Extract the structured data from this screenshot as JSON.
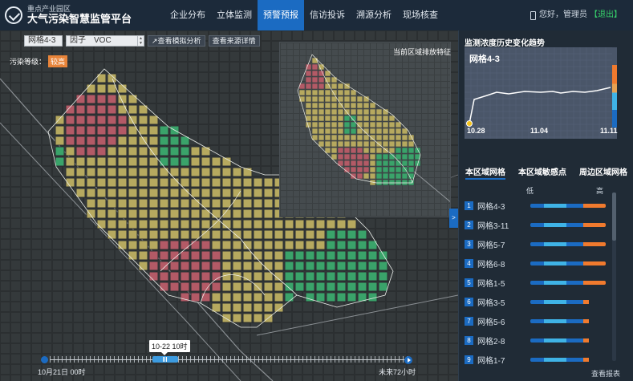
{
  "header": {
    "subtitle": "重点产业园区",
    "title": "大气污染智慧监管平台",
    "nav": [
      "企业分布",
      "立体监测",
      "预警预报",
      "信访投诉",
      "溯源分析",
      "现场核查"
    ],
    "active_nav_index": 2,
    "user_greeting": "您好，管理员",
    "logout": "【退出】"
  },
  "toolbar": {
    "grid_select": "网格4-3",
    "factor_label": "因子",
    "factor_value": "VOC",
    "btn_simulation": "查看模拟分析",
    "btn_source": "查看来源详情"
  },
  "pollution": {
    "label": "污染等级：",
    "level": "较高",
    "level_color": "#e8843a"
  },
  "inset": {
    "title": "当前区域排放特征"
  },
  "timeline": {
    "tooltip": "10-22 10时",
    "start": "10月21日 00时",
    "end": "未来72小时",
    "position_percent": 31
  },
  "panel": {
    "trend_title": "监测浓度历史变化趋势",
    "trend_grid": "网格4-3",
    "trend_x_labels": [
      "10.28",
      "11.04",
      "11.11"
    ],
    "tabs": [
      "本区域网格",
      "本区域敏感点",
      "周边区域网格"
    ],
    "active_tab": 0,
    "legend_low": "低",
    "legend_high": "高",
    "rows": [
      {
        "idx": "1",
        "name": "网格4-3",
        "level": 1.0
      },
      {
        "idx": "2",
        "name": "网格3-11",
        "level": 1.0
      },
      {
        "idx": "3",
        "name": "网格5-7",
        "level": 1.0
      },
      {
        "idx": "4",
        "name": "网格6-8",
        "level": 1.0
      },
      {
        "idx": "5",
        "name": "网格1-5",
        "level": 1.0
      },
      {
        "idx": "6",
        "name": "网格3-5",
        "level": 0.78
      },
      {
        "idx": "7",
        "name": "网格5-6",
        "level": 0.78
      },
      {
        "idx": "8",
        "name": "网格2-8",
        "level": 0.78
      },
      {
        "idx": "9",
        "name": "网格1-7",
        "level": 0.78
      }
    ],
    "report_link": "查看报表"
  },
  "colors": {
    "accent": "#1b6bc2",
    "high": "#f07a2e",
    "mid": "#3fb3e6",
    "low": "#1b6bc2",
    "red_cell": "#b35a66",
    "yellow_cell": "#b6a95f",
    "green_cell": "#3aa36a"
  }
}
